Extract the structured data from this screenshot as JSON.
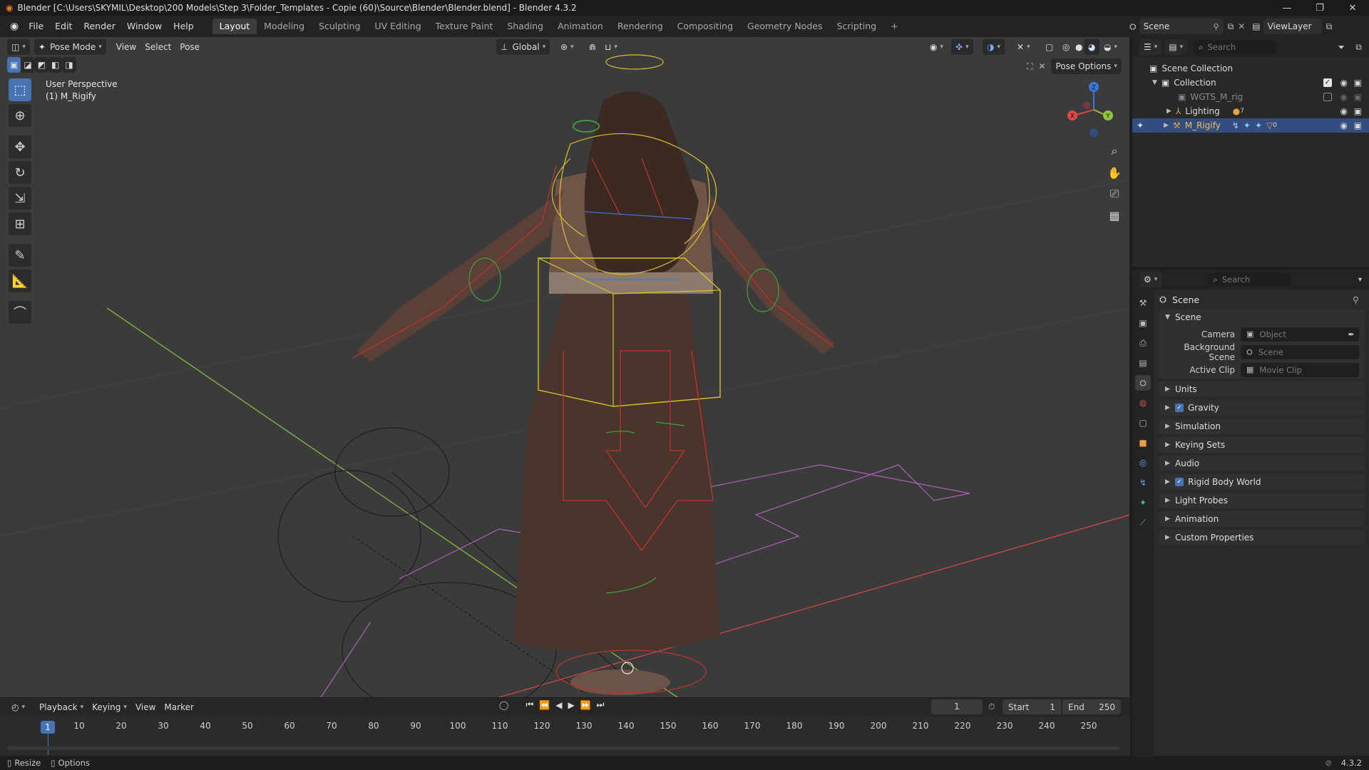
{
  "window": {
    "title": "Blender [C:\\Users\\SKYMIL\\Desktop\\200 Models\\Step 3\\Folder_Templates - Copie (60)\\Source\\Blender\\Blender.blend] - Blender 4.3.2",
    "minimize": "—",
    "maximize": "❐",
    "close": "✕"
  },
  "menu": [
    "File",
    "Edit",
    "Render",
    "Window",
    "Help"
  ],
  "workspaces": [
    "Layout",
    "Modeling",
    "Sculpting",
    "UV Editing",
    "Texture Paint",
    "Shading",
    "Animation",
    "Rendering",
    "Compositing",
    "Geometry Nodes",
    "Scripting"
  ],
  "add_workspace": "+",
  "scene_selector": "Scene",
  "view_layer": "ViewLayer",
  "viewport": {
    "mode": "Pose Mode",
    "menus": [
      "View",
      "Select",
      "Pose"
    ],
    "orientation": "Global",
    "pose_options": "Pose Options",
    "info_line1": "User Perspective",
    "info_line2": "(1) M_Rigify",
    "gizmo": {
      "x": "X",
      "y": "Y",
      "z": "Z"
    }
  },
  "timeline": {
    "menus": [
      "Playback",
      "Keying",
      "View",
      "Marker"
    ],
    "current_frame": "1",
    "start_label": "Start",
    "start": "1",
    "end_label": "End",
    "end": "250",
    "ticks": [
      "10",
      "20",
      "30",
      "40",
      "50",
      "60",
      "70",
      "80",
      "90",
      "100",
      "110",
      "120",
      "130",
      "140",
      "150",
      "160",
      "170",
      "180",
      "190",
      "200",
      "210",
      "220",
      "230",
      "240",
      "250"
    ],
    "playhead": "1"
  },
  "statusbar": {
    "resize": "Resize",
    "options": "Options",
    "version": "4.3.2"
  },
  "outliner": {
    "search_placeholder": "Search",
    "items": [
      {
        "label": "Scene Collection"
      },
      {
        "label": "Collection"
      },
      {
        "label": "WGTS_M_rig"
      },
      {
        "label": "Lighting",
        "badge": "7"
      },
      {
        "label": "M_Rigify",
        "badge": "0"
      }
    ]
  },
  "properties": {
    "search_placeholder": "Search",
    "crumb": "Scene",
    "scene_panel": "Scene",
    "fields": [
      {
        "label": "Camera",
        "placeholder": "Object"
      },
      {
        "label": "Background Scene",
        "placeholder": "Scene"
      },
      {
        "label": "Active Clip",
        "placeholder": "Movie Clip"
      }
    ],
    "panels": [
      {
        "label": "Units",
        "check": false
      },
      {
        "label": "Gravity",
        "check": true
      },
      {
        "label": "Simulation",
        "check": false
      },
      {
        "label": "Keying Sets",
        "check": false
      },
      {
        "label": "Audio",
        "check": false
      },
      {
        "label": "Rigid Body World",
        "check": true
      },
      {
        "label": "Light Probes",
        "check": false
      },
      {
        "label": "Animation",
        "check": false
      },
      {
        "label": "Custom Properties",
        "check": false
      }
    ]
  },
  "colors": {
    "accent": "#4772b3",
    "viewport_bg": "#3b3b3b",
    "bone_yellow": "#d8c02a",
    "bone_green": "#3fa33f",
    "bone_red": "#c23232",
    "axis_x": "#e04848",
    "axis_y": "#8cc63f",
    "axis_z": "#3c78d8"
  }
}
